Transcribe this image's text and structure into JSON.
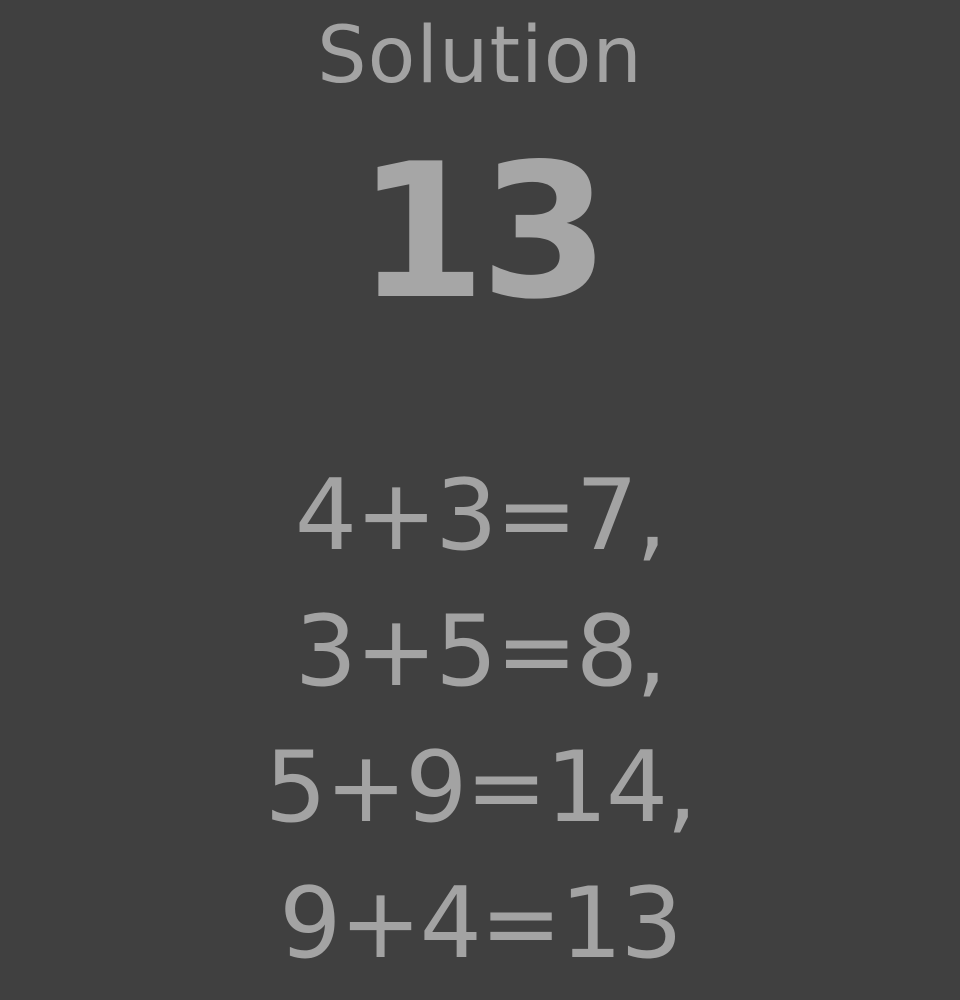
{
  "header": {
    "title": "Solution"
  },
  "result": {
    "value": "13"
  },
  "steps": [
    "4+3=7,",
    "3+5=8,",
    "5+9=14,",
    "9+4=13"
  ],
  "colors": {
    "background": "#404040",
    "text": "#a3a3a3"
  }
}
